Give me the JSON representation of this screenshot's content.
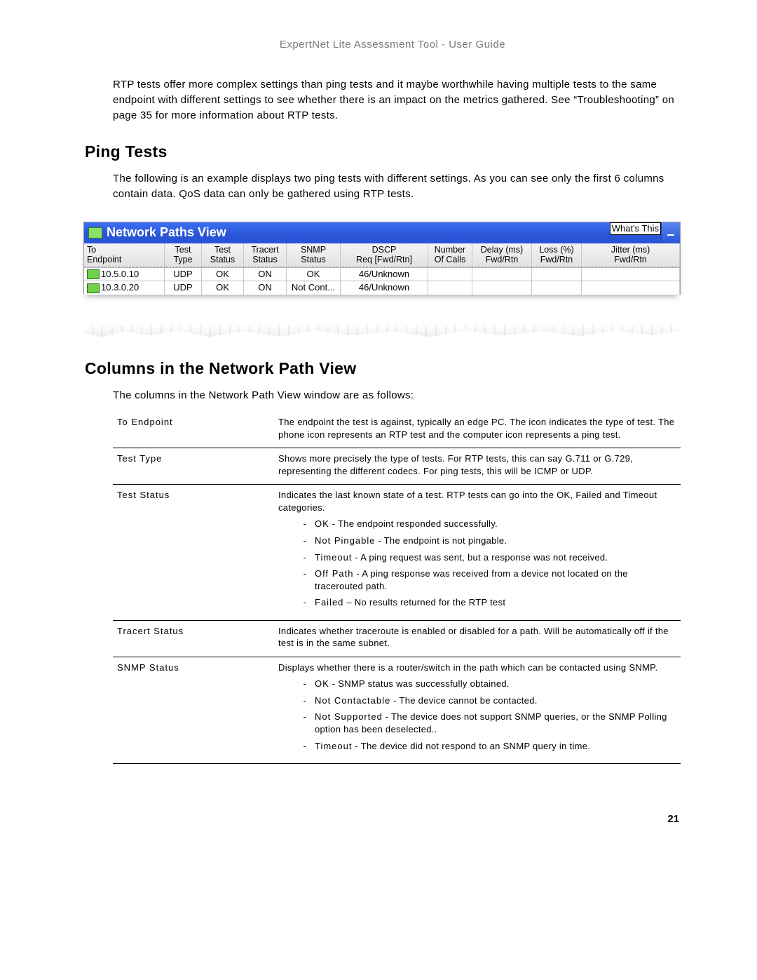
{
  "header": "ExpertNet Lite Assessment Tool - User Guide",
  "intro_paragraph": "RTP tests offer more complex settings than ping tests and it maybe worthwhile having multiple tests to the same endpoint with different settings to see whether there is an impact on the metrics gathered. See “Troubleshooting” on page 35 for more information about RTP tests.",
  "section_ping_heading": "Ping Tests",
  "ping_paragraph": "The following is an example displays two ping tests with different settings. As you can see only the first 6 columns contain data. QoS data can only be gathered using RTP tests.",
  "npv": {
    "title": "Network Paths View",
    "whats_this": "What's This",
    "columns": [
      "To\nEndpoint",
      "Test\nType",
      "Test\nStatus",
      "Tracert\nStatus",
      "SNMP\nStatus",
      "DSCP\nReq [Fwd/Rtn]",
      "Number\nOf Calls",
      "Delay (ms)\nFwd/Rtn",
      "Loss (%)\nFwd/Rtn",
      "Jitter (ms)\nFwd/Rtn"
    ],
    "rows": [
      {
        "endpoint": "10.5.0.10",
        "type": "UDP",
        "status": "OK",
        "tracert": "ON",
        "snmp": "OK",
        "dscp": "46/Unknown",
        "calls": "",
        "delay": "",
        "loss": "",
        "jitter": ""
      },
      {
        "endpoint": "10.3.0.20",
        "type": "UDP",
        "status": "OK",
        "tracert": "ON",
        "snmp": "Not Cont...",
        "dscp": "46/Unknown",
        "calls": "",
        "delay": "",
        "loss": "",
        "jitter": ""
      }
    ]
  },
  "section_cols_heading": "Columns in the Network Path View",
  "cols_intro": "The columns in the Network Path View window are as follows:",
  "defs": [
    {
      "term": "To Endpoint",
      "desc": "The endpoint the test is against, typically an edge PC. The icon indicates the type of test. The phone icon represents an RTP test and the computer icon represents a ping test."
    },
    {
      "term": "Test Type",
      "desc": "Shows more precisely the type of tests. For RTP tests, this can say G.711 or G.729, representing the different codecs. For ping tests, this will be ICMP or UDP."
    },
    {
      "term": "Test Status",
      "desc": "Indicates the last known state of a test. RTP tests can go into the OK, Failed and Timeout categories.",
      "items": [
        {
          "label": "OK",
          "text": " - The endpoint responded successfully."
        },
        {
          "label": "Not Pingable",
          "text": " - The endpoint is not pingable."
        },
        {
          "label": "Timeout",
          "text": " - A ping request was sent, but a response was not received."
        },
        {
          "label": "Off Path",
          "text": " - A ping response was received from a device not located on the tracerouted path."
        },
        {
          "label": "Failed",
          "text": " – No results returned for the RTP test"
        }
      ]
    },
    {
      "term": "Tracert Status",
      "desc": "Indicates whether traceroute is enabled or disabled for a path. Will be automatically off if the test is in the same subnet."
    },
    {
      "term": "SNMP Status",
      "desc": "Displays whether there is a router/switch in the path which can be contacted using SNMP.",
      "items": [
        {
          "label": "OK",
          "text": " - SNMP status was successfully obtained."
        },
        {
          "label": "Not Contactable",
          "text": " - The device cannot be contacted."
        },
        {
          "label": "Not Supported",
          "text": " - The device does not support SNMP queries, or the SNMP Polling option has been deselected.."
        },
        {
          "label": "Timeout",
          "text": " - The device did not respond to an SNMP query in time."
        }
      ]
    }
  ],
  "page_number": "21"
}
